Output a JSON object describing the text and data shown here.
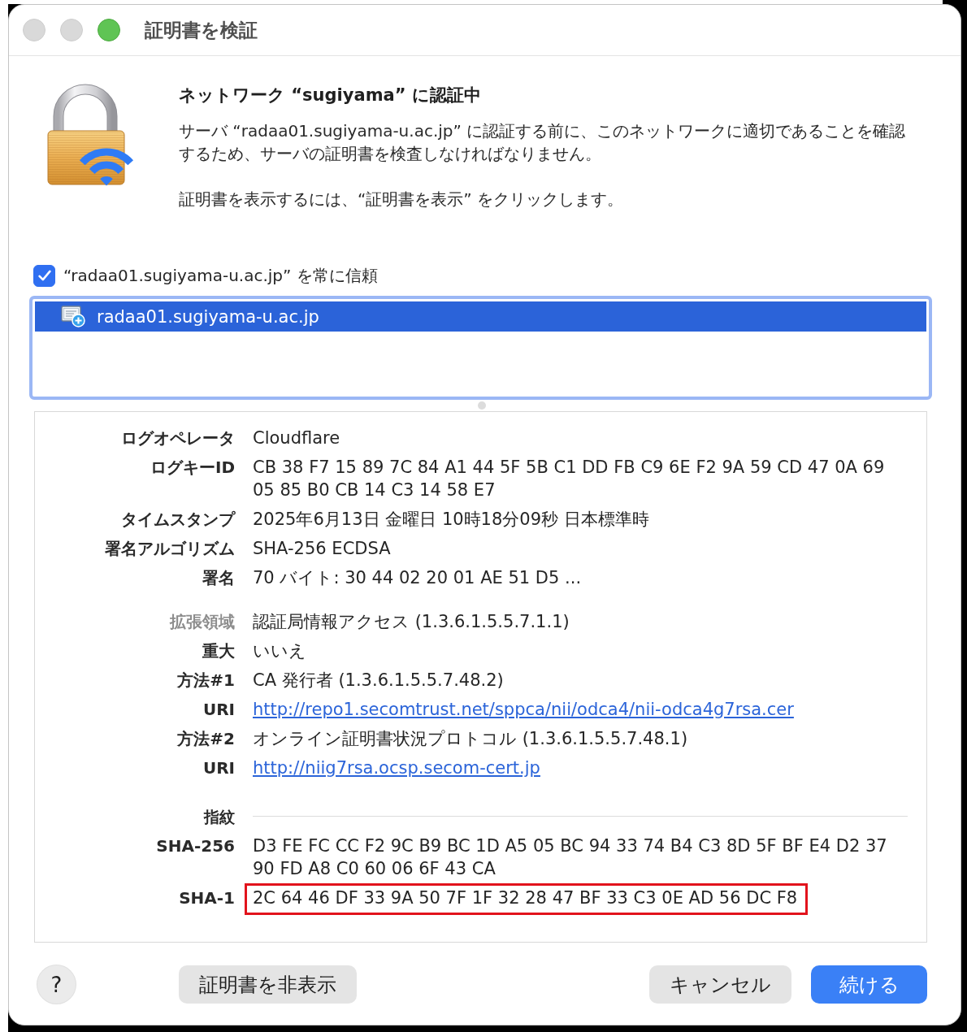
{
  "window": {
    "title": "証明書を検証",
    "controls": [
      {
        "kind": "close",
        "enabled": false
      },
      {
        "kind": "minimize",
        "enabled": false
      },
      {
        "kind": "zoom",
        "enabled": true
      }
    ]
  },
  "header": {
    "title": "ネットワーク “sugiyama” に認証中",
    "paragraphs": [
      "サーバ “radaa01.sugiyama-u.ac.jp” に認証する前に、このネットワークに適切であることを確認するため、サーバの証明書を検査しなければなりません。",
      "証明書を表示するには、“証明書を表示” をクリックします。"
    ]
  },
  "trust": {
    "label": "“radaa01.sugiyama-u.ac.jp” を常に信頼",
    "checked": true
  },
  "certificates": [
    {
      "name": "radaa01.sugiyama-u.ac.jp",
      "selected": true
    }
  ],
  "details": {
    "rows": [
      {
        "kind": "field",
        "label": "ログオペレータ",
        "value": "Cloudflare",
        "highlighted": false
      },
      {
        "kind": "field",
        "label": "ログキーID",
        "value": "CB 38 F7 15 89 7C 84 A1 44 5F 5B C1 DD FB C9 6E F2 9A 59 CD 47 0A 69 05 85 B0 CB 14 C3 14 58 E7",
        "highlighted": false
      },
      {
        "kind": "field",
        "label": "タイムスタンプ",
        "value": "2025年6月13日 金曜日 10時18分09秒 日本標準時",
        "highlighted": false
      },
      {
        "kind": "field",
        "label": "署名アルゴリズム",
        "value": "SHA-256 ECDSA",
        "highlighted": false
      },
      {
        "kind": "field",
        "label": "署名",
        "value": "70 バイト: 30 44 02 20 01 AE 51 D5 ...",
        "highlighted": false
      },
      {
        "kind": "section",
        "label": "拡張領域",
        "value": "認証局情報アクセス (1.3.6.1.5.5.7.1.1)",
        "highlighted": false
      },
      {
        "kind": "field",
        "label": "重大",
        "value": "いいえ",
        "highlighted": false
      },
      {
        "kind": "field",
        "label": "方法#1",
        "value": "CA 発行者 (1.3.6.1.5.5.7.48.2)",
        "highlighted": false
      },
      {
        "kind": "link",
        "label": "URI",
        "value": "http://repo1.secomtrust.net/sppca/nii/odca4/nii-odca4g7rsa.cer",
        "highlighted": false
      },
      {
        "kind": "field",
        "label": "方法#2",
        "value": "オンライン証明書状況プロトコル (1.3.6.1.5.5.7.48.1)",
        "highlighted": false
      },
      {
        "kind": "link",
        "label": "URI",
        "value": "http://niig7rsa.ocsp.secom-cert.jp",
        "highlighted": false
      },
      {
        "kind": "group",
        "label": "指紋",
        "highlighted": false
      },
      {
        "kind": "field",
        "label": "SHA-256",
        "value": "D3 FE FC CC F2 9C B9 BC 1D A5 05 BC 94 33 74 B4 C3 8D 5F BF E4 D2 37 90 FD A8 C0 60 06 6F 43 CA",
        "highlighted": false
      },
      {
        "kind": "field",
        "label": "SHA-1",
        "value": "2C 64 46 DF 33 9A 50 7F 1F 32 28 47 BF 33 C3 0E AD 56 DC F8",
        "highlighted": true
      }
    ]
  },
  "footer": {
    "left": [
      {
        "kind": "help",
        "label": "?"
      },
      {
        "kind": "secondary",
        "label": "証明書を非表示"
      }
    ],
    "right": [
      {
        "kind": "secondary",
        "label": "キャンセル"
      },
      {
        "kind": "primary",
        "label": "続ける"
      }
    ]
  }
}
